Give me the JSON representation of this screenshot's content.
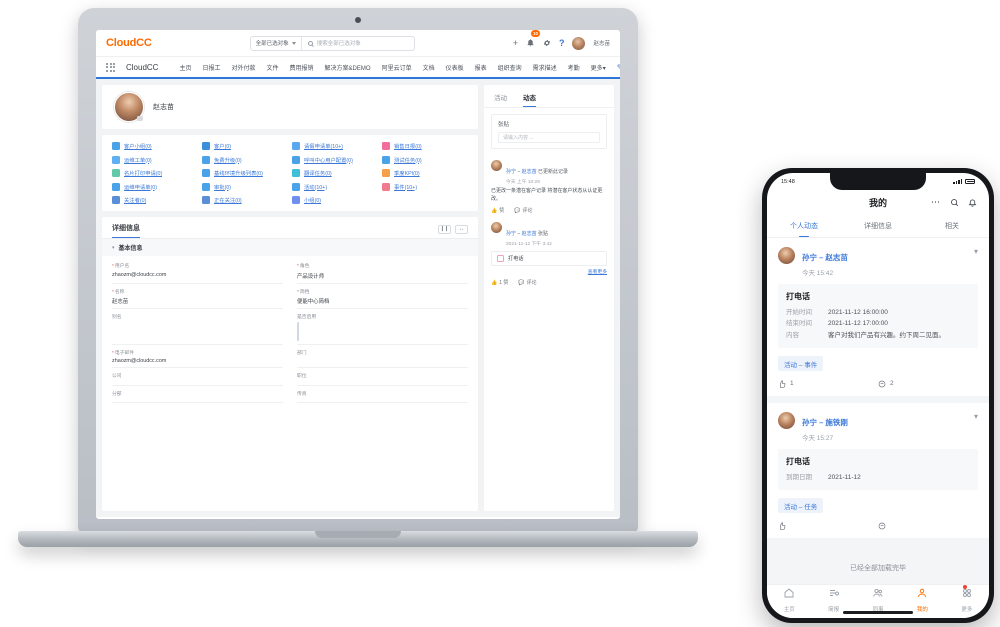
{
  "web": {
    "brand": "CloudCC",
    "topbar": {
      "search_scope": "全部已选对象",
      "search_placeholder": "搜索全部已选对象",
      "notification_count": "10",
      "user_name": "赵志苗",
      "icons": {
        "plus": "+",
        "bell": "bell-icon",
        "gear": "gear-icon",
        "help": "?"
      }
    },
    "nav": {
      "app_name": "CloudCC",
      "items": [
        "主页",
        "日报工",
        "对外付款",
        "文件",
        "费用报销",
        "解决方案&DEMO",
        "阿里云订单",
        "文档",
        "仪表板",
        "报表",
        "组织查询",
        "需求描述",
        "考勤",
        "更多"
      ],
      "more_label": "更多",
      "edit_icon": "pencil-icon"
    },
    "profile": {
      "name": "赵志苗",
      "avatar": "user-avatar",
      "camera_icon": "camera-icon"
    },
    "apps": [
      {
        "label": "客户小组(0)",
        "color": "#4aa3e8"
      },
      {
        "label": "客户(0)",
        "color": "#3b8fd8"
      },
      {
        "label": "请假申请单(10+)",
        "color": "#5aa9f0"
      },
      {
        "label": "销售日报(0)",
        "color": "#f06d9e"
      },
      {
        "label": "运维工单(0)",
        "color": "#5fb0f2"
      },
      {
        "label": "免费升级(0)",
        "color": "#4aa3e8"
      },
      {
        "label": "呼叫中心用户配置(0)",
        "color": "#4aa3e8"
      },
      {
        "label": "测试任务(0)",
        "color": "#4aa3e8"
      },
      {
        "label": "名片打印申请(0)",
        "color": "#63c9a8"
      },
      {
        "label": "基线环境升级列表(0)",
        "color": "#4aa3e8"
      },
      {
        "label": "翻译任务(0)",
        "color": "#3fc0d8"
      },
      {
        "label": "季度KPI(0)",
        "color": "#f5a04a"
      },
      {
        "label": "运维申请单(0)",
        "color": "#4aa3e8"
      },
      {
        "label": "审批(0)",
        "color": "#4aa3e8"
      },
      {
        "label": "活动(10+)",
        "color": "#4aa3e8"
      },
      {
        "label": "事件(10+)",
        "color": "#f07a8e"
      },
      {
        "label": "关注者(0)",
        "color": "#5a8fd8"
      },
      {
        "label": "正在关注(0)",
        "color": "#5a8fd8"
      },
      {
        "label": "小组(0)",
        "color": "#6f8ff0"
      },
      {
        "label": "",
        "color": "transparent"
      }
    ],
    "detail": {
      "tab": "详细信息",
      "pause_icon": "pause-icon",
      "expand_icon": "expand-icon",
      "section_title": "基本信息",
      "fields": [
        {
          "label": "用户名",
          "value": "zhaozm@cloudcc.com",
          "required": true,
          "type": "text"
        },
        {
          "label": "角色",
          "value": "产品设计师",
          "required": true,
          "type": "text"
        },
        {
          "label": "名称",
          "value": "赵志苗",
          "required": true,
          "type": "text"
        },
        {
          "label": "简档",
          "value": "便能中心简档",
          "required": true,
          "type": "text"
        },
        {
          "label": "别名",
          "value": "",
          "required": false,
          "type": "text"
        },
        {
          "label": "是否启用",
          "value": "",
          "required": false,
          "type": "checkbox"
        },
        {
          "label": "电子邮件",
          "value": "zhaozm@cloudcc.com",
          "required": true,
          "type": "text"
        },
        {
          "label": "部门",
          "value": "",
          "required": false,
          "type": "text"
        },
        {
          "label": "公司",
          "value": "",
          "required": false,
          "type": "text"
        },
        {
          "label": "职位",
          "value": "",
          "required": false,
          "type": "text"
        },
        {
          "label": "分部",
          "value": "",
          "required": false,
          "type": "text"
        },
        {
          "label": "传真",
          "value": "",
          "required": false,
          "type": "text"
        }
      ]
    },
    "activity": {
      "tabs": [
        {
          "label": "活动",
          "active": false
        },
        {
          "label": "动态",
          "active": true
        }
      ],
      "composer_label": "张贴",
      "composer_placeholder": "请输入内容 ...",
      "posts": [
        {
          "actor": "孙宁",
          "dash": "–",
          "target": "赵志苗",
          "action": "已更新此记录",
          "time": "今天 上午 10:29",
          "body": "已更改一条潜在客户记录 将潜在客户状态从认证更改。",
          "like_label": "赞",
          "comment_label": "评论"
        },
        {
          "actor": "孙宁",
          "dash": "–",
          "target": "赵志苗",
          "action": "张贴",
          "time": "2021-11-12 下午 3:42",
          "chip": "打电话",
          "more_label": "查看更多",
          "like_label": "1 赞",
          "comment_label": "评论"
        }
      ]
    }
  },
  "phone": {
    "status": {
      "time": "15:48",
      "carrier": "",
      "battery": "battery-icon"
    },
    "header": {
      "title": "我的",
      "more_icon": "more-icon",
      "search_icon": "search-icon",
      "bell_icon": "bell-icon"
    },
    "tabs": [
      {
        "label": "个人动态",
        "active": true
      },
      {
        "label": "详细信息",
        "active": false
      },
      {
        "label": "相关",
        "active": false
      }
    ],
    "cards": [
      {
        "actor": "孙宁",
        "dash": "–",
        "target": "赵志苗",
        "time": "今天 15:42",
        "panel_title": "打电话",
        "rows": [
          {
            "key": "开始时间",
            "value": "2021-11-12 16:00:00"
          },
          {
            "key": "结束时间",
            "value": "2021-11-12 17:00:00"
          },
          {
            "key": "内容",
            "value": "客户对我们产品有兴趣。约下周二见面。"
          }
        ],
        "tag": "活动 – 事件",
        "like_count": "1",
        "comment_count": "2"
      },
      {
        "actor": "孙宁",
        "dash": "–",
        "target": "施铁刚",
        "time": "今天 15:27",
        "panel_title": "打电话",
        "rows": [
          {
            "key": "到期日期",
            "value": "2021-11-12"
          }
        ],
        "tag": "活动 – 任务",
        "like_count": "",
        "comment_count": ""
      }
    ],
    "end_text": "已经全部加载完毕",
    "nav": [
      {
        "label": "主页",
        "icon": "home-icon",
        "active": false,
        "badge": false
      },
      {
        "label": "简报",
        "icon": "list-icon",
        "active": false,
        "badge": false
      },
      {
        "label": "同事",
        "icon": "people-icon",
        "active": false,
        "badge": false
      },
      {
        "label": "我的",
        "icon": "person-icon",
        "active": true,
        "badge": false
      },
      {
        "label": "更多",
        "icon": "grid-icon",
        "active": false,
        "badge": true
      }
    ]
  },
  "colors": {
    "brand": "#ff6a00",
    "accent": "#3b78d8",
    "nav_underline": "#2d77d8"
  }
}
